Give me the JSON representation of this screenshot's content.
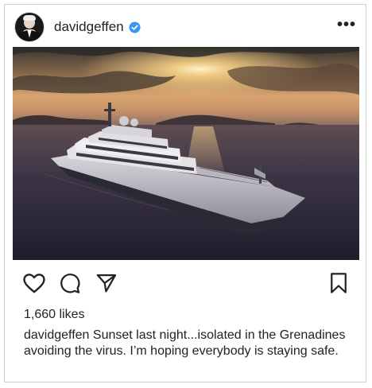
{
  "post": {
    "username": "davidgeffen",
    "more_label": "•••",
    "likes": "1,660 likes",
    "caption_user": "davidgeffen",
    "caption_text": "Sunset last night...isolated in the Grenadines avoiding the virus.  I’m hoping everybody is staying safe."
  },
  "icons": {
    "verified": "verified-badge-icon",
    "like": "heart-icon",
    "comment": "comment-icon",
    "share": "send-icon",
    "save": "bookmark-icon"
  },
  "colors": {
    "verified_blue": "#3897f0",
    "text": "#222222"
  }
}
